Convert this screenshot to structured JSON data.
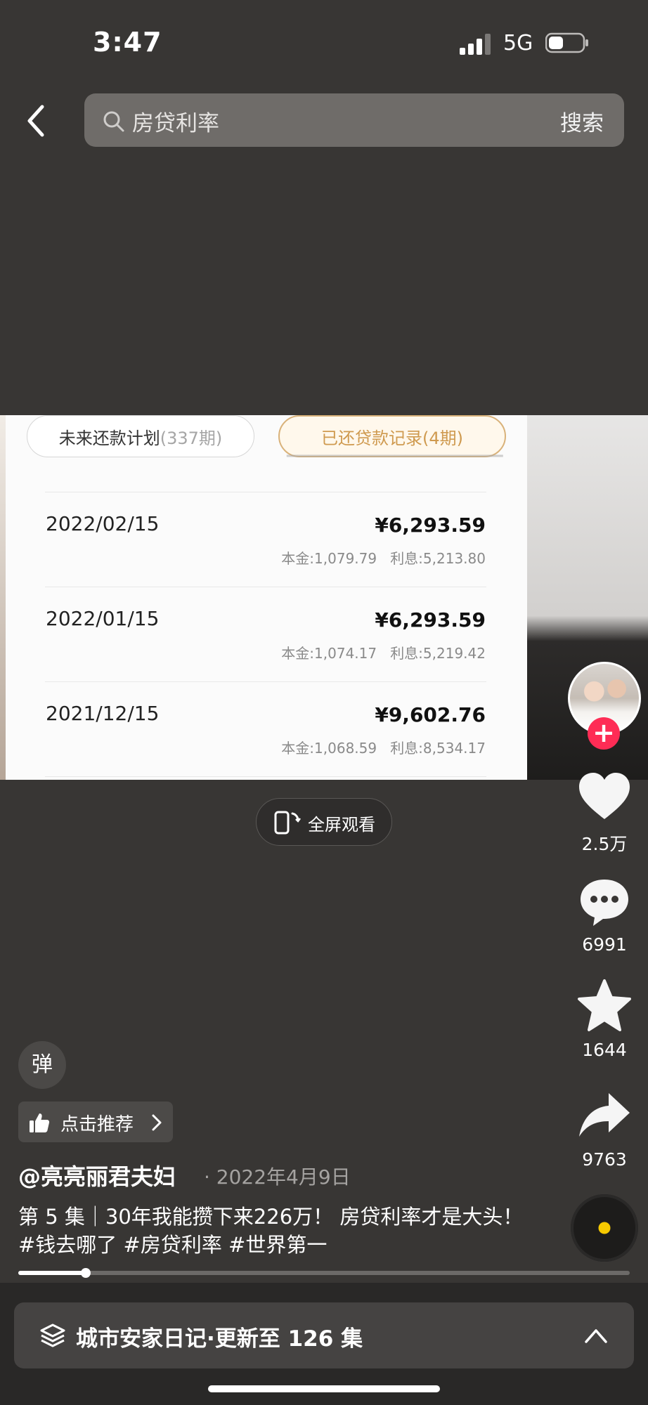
{
  "status_bar": {
    "time": "3:47",
    "network": "5G"
  },
  "search": {
    "query": "房贷利率",
    "button_label": "搜索"
  },
  "video": {
    "tabs": [
      {
        "label": "未来还款计划",
        "count": "(337期)"
      },
      {
        "label": "已还贷款记录",
        "count": "(4期)"
      }
    ],
    "records": [
      {
        "date": "2022/02/15",
        "amount": "¥6,293.59",
        "principal": "本金:1,079.79",
        "interest": "利息:5,213.80"
      },
      {
        "date": "2022/01/15",
        "amount": "¥6,293.59",
        "principal": "本金:1,074.17",
        "interest": "利息:5,219.42"
      },
      {
        "date": "2021/12/15",
        "amount": "¥9,602.76",
        "principal": "本金:1,068.59",
        "interest": "利息:8,534.17"
      }
    ]
  },
  "fullscreen_label": "全屏观看",
  "rail": {
    "likes": "2.5万",
    "comments": "6991",
    "favorites": "1644",
    "shares": "9763"
  },
  "danmu_label": "弹",
  "recommend_label": "点击推荐",
  "post": {
    "author": "@亮亮丽君夫妇",
    "date": "· 2022年4月9日",
    "caption": "第 5 集｜30年我能攒下来226万！ 房贷利率才是大头！ #钱去哪了 #房贷利率 #世界第一"
  },
  "playback": {
    "progress": 0.11
  },
  "series": {
    "label": "城市安家日记·更新至 126 集"
  },
  "colors": {
    "accent_red": "#fe2c55",
    "tab_gold": "#cf9a4f"
  }
}
